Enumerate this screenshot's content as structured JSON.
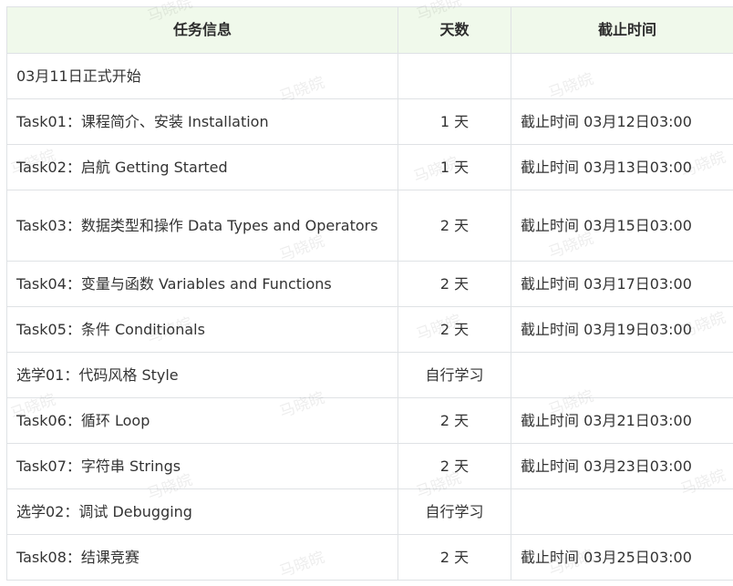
{
  "table": {
    "headers": [
      "任务信息",
      "天数",
      "截止时间"
    ],
    "rows": [
      {
        "task": "03月11日正式开始",
        "days": "",
        "deadline": ""
      },
      {
        "task": "Task01：课程简介、安装 Installation",
        "days": "1 天",
        "deadline": "截止时间 03月12日03:00"
      },
      {
        "task": "Task02：启航 Getting Started",
        "days": "1 天",
        "deadline": "截止时间 03月13日03:00"
      },
      {
        "task": "Task03：数据类型和操作 Data Types and Operators",
        "days": "2 天",
        "deadline": "截止时间 03月15日03:00"
      },
      {
        "task": "Task04：变量与函数 Variables and Functions",
        "days": "2 天",
        "deadline": "截止时间 03月17日03:00"
      },
      {
        "task": "Task05：条件 Conditionals",
        "days": "2 天",
        "deadline": "截止时间 03月19日03:00"
      },
      {
        "task": "选学01：代码风格 Style",
        "days": "自行学习",
        "deadline": ""
      },
      {
        "task": "Task06：循环 Loop",
        "days": "2 天",
        "deadline": "截止时间 03月21日03:00"
      },
      {
        "task": "Task07：字符串 Strings",
        "days": "2 天",
        "deadline": "截止时间 03月23日03:00"
      },
      {
        "task": "选学02：调试 Debugging",
        "days": "自行学习",
        "deadline": ""
      },
      {
        "task": "Task08：结课竞赛",
        "days": "2 天",
        "deadline": "截止时间 03月25日03:00"
      }
    ]
  },
  "watermark": {
    "text": "马晓皖"
  }
}
